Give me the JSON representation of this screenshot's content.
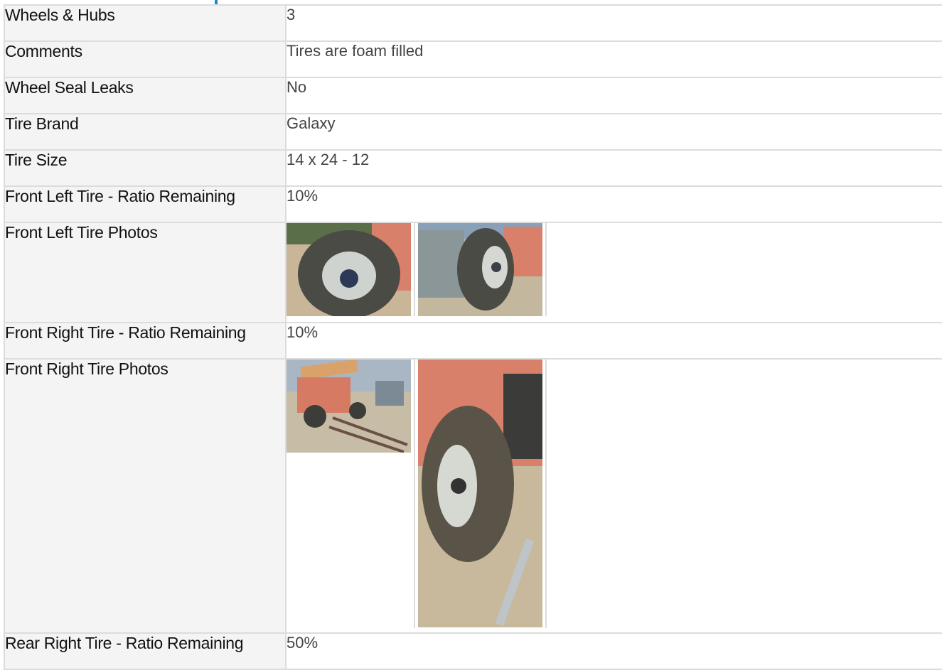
{
  "rows": [
    {
      "label": "Wheels & Hubs",
      "value": "3"
    },
    {
      "label": "Comments",
      "value": "Tires are foam filled"
    },
    {
      "label": "Wheel Seal Leaks",
      "value": "No"
    },
    {
      "label": "Tire Brand",
      "value": "Galaxy"
    },
    {
      "label": "Tire Size",
      "value": "14 x 24 - 12"
    },
    {
      "label": "Front Left Tire - Ratio Remaining",
      "value": "10%"
    },
    {
      "label": "Front Left Tire Photos"
    },
    {
      "label": "Front Right Tire - Ratio Remaining",
      "value": "10%"
    },
    {
      "label": "Front Right Tire Photos"
    },
    {
      "label": "Rear Right Tire - Ratio Remaining",
      "value": "50%"
    }
  ],
  "colors": {
    "accent": "#1a88d8",
    "label_bg": "#f4f4f4",
    "border": "#dcdcdc"
  }
}
